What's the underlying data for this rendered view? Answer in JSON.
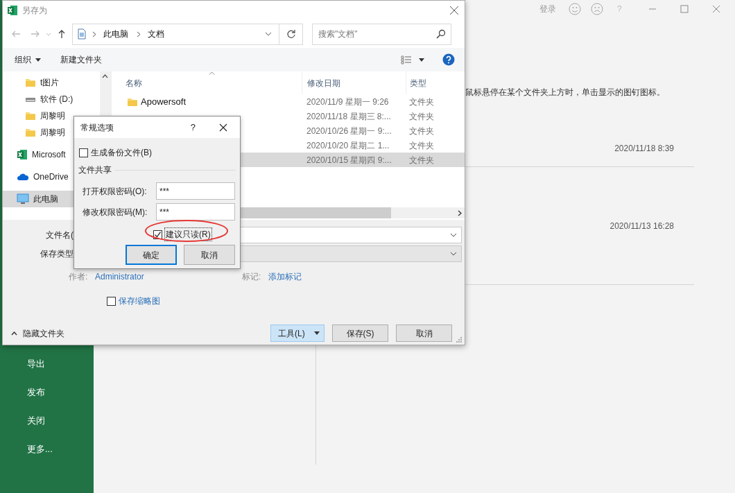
{
  "excel": {
    "title_bar": {
      "sign_in": "登录",
      "help": "?"
    },
    "menu": [
      "导出",
      "发布",
      "关闭",
      "更多..."
    ],
    "tip": "鼠标悬停在某个文件夹上方时，单击显示的图钉图标。",
    "recent_dates": [
      "2020/11/18 8:39",
      "2020/11/13 16:28"
    ]
  },
  "save_dialog": {
    "title": "另存为",
    "path": [
      "此电脑",
      "文档"
    ],
    "search_placeholder": "搜索\"文档\"",
    "toolbar": {
      "organize": "组织",
      "new_folder": "新建文件夹"
    },
    "nav": [
      {
        "label": "t图片",
        "kind": "folder",
        "selected": false
      },
      {
        "label": "软件 (D:)",
        "kind": "drive",
        "selected": false
      },
      {
        "label": "周黎明",
        "kind": "folder",
        "selected": false
      },
      {
        "label": "周黎明",
        "kind": "folder",
        "selected": false
      },
      {
        "label": "Microsoft",
        "kind": "excel",
        "selected": false
      },
      {
        "label": "OneDrive",
        "kind": "cloud",
        "selected": false
      },
      {
        "label": "此电脑",
        "kind": "pc",
        "selected": true
      }
    ],
    "columns": [
      "名称",
      "修改日期",
      "类型"
    ],
    "files": [
      {
        "name": "Apowersoft",
        "date": "2020/11/9 星期一 9:26",
        "type": "文件夹",
        "selected": false
      },
      {
        "date": "2020/11/18 星期三 8:...",
        "type": "文件夹",
        "selected": false
      },
      {
        "date": "2020/10/26 星期一 9:...",
        "type": "文件夹",
        "selected": false
      },
      {
        "date": "2020/10/20 星期二 1...",
        "type": "文件夹",
        "selected": false
      },
      {
        "date": "2020/10/15 星期四 9:...",
        "type": "文件夹",
        "selected": true
      }
    ],
    "filename_label": "文件名(",
    "filetype_label": "保存类型",
    "author_label": "作者:",
    "author": "Administrator",
    "tags_label": "标记:",
    "tags": "添加标记",
    "thumbnail": {
      "label": "保存缩略图",
      "checked": false
    },
    "hide_folders": "隐藏文件夹",
    "buttons": [
      {
        "label": "工具(L)",
        "kind": "menu"
      },
      {
        "label": "保存(S)",
        "kind": "plain"
      },
      {
        "label": "取消",
        "kind": "plain"
      }
    ]
  },
  "options_dialog": {
    "title": "常规选项",
    "help": "?",
    "backup": {
      "label": "生成备份文件(B)",
      "checked": false
    },
    "section": "文件共享",
    "fields": [
      {
        "label": "打开权限密码(O):",
        "value": "***"
      },
      {
        "label": "修改权限密码(M):",
        "value": "***"
      }
    ],
    "read_only": {
      "label": "建议只读(R)",
      "checked": true
    },
    "buttons": [
      {
        "label": "确定",
        "default": true
      },
      {
        "label": "取消",
        "default": false
      }
    ]
  }
}
